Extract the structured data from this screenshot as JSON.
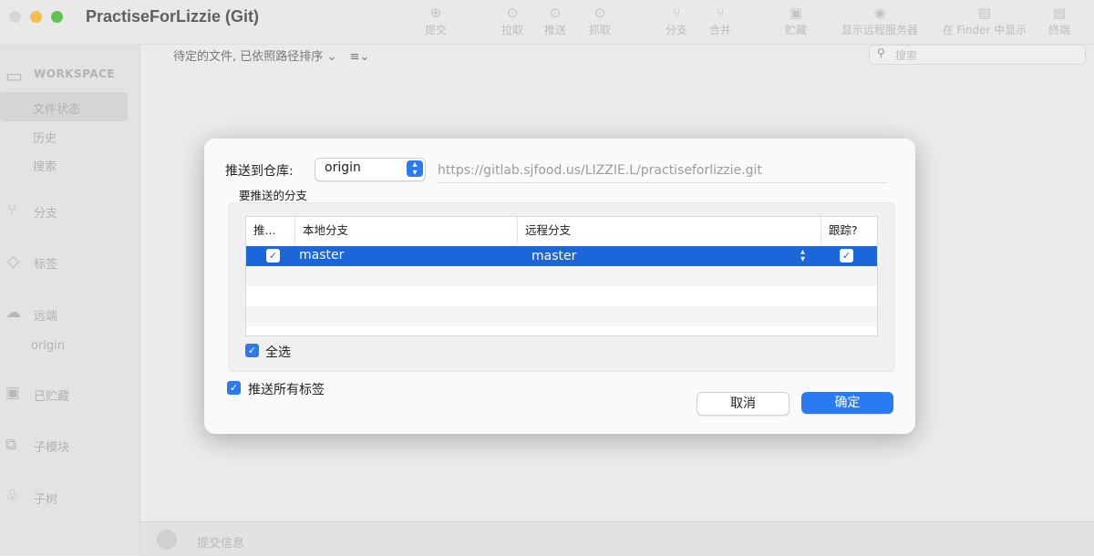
{
  "app": {
    "title": "PractiseForLizzie (Git)"
  },
  "toolbar": {
    "items": [
      {
        "label": "提交",
        "icon": "commit-icon"
      },
      {
        "label": "拉取",
        "icon": "pull-icon"
      },
      {
        "label": "推送",
        "icon": "push-icon"
      },
      {
        "label": "抓取",
        "icon": "fetch-icon"
      },
      {
        "label": "分支",
        "icon": "branch-icon"
      },
      {
        "label": "合并",
        "icon": "merge-icon"
      },
      {
        "label": "贮藏",
        "icon": "stash-icon"
      },
      {
        "label": "显示远程服务器",
        "icon": "remote-icon"
      },
      {
        "label": "在 Finder 中显示",
        "icon": "finder-icon"
      },
      {
        "label": "终端",
        "icon": "terminal-icon"
      }
    ]
  },
  "sidebar": {
    "workspace_label": "WORKSPACE",
    "items": [
      {
        "label": "文件状态"
      },
      {
        "label": "历史"
      },
      {
        "label": "搜索"
      }
    ],
    "sections": [
      {
        "label": "分支",
        "icon": "branch-icon"
      },
      {
        "label": "标签",
        "icon": "tag-icon"
      },
      {
        "label": "远端",
        "icon": "cloud-icon"
      },
      {
        "label": "已贮藏",
        "icon": "stash-icon"
      },
      {
        "label": "子模块",
        "icon": "submodule-icon"
      },
      {
        "label": "子树",
        "icon": "subtree-icon"
      }
    ],
    "remote_origin": "origin"
  },
  "main": {
    "filter_text": "待定的文件, 已依照路径排序",
    "search_placeholder": "搜索",
    "bottom_label": "提交信息"
  },
  "dialog": {
    "push_to_label": "推送到仓库:",
    "repo_value": "origin",
    "repo_url": "https://gitlab.sjfood.us/LIZZIE.L/practiseforlizzie.git",
    "branches_group_label": "要推送的分支",
    "table": {
      "headers": [
        "推...",
        "本地分支",
        "远程分支",
        "跟踪?"
      ],
      "rows": [
        {
          "push": true,
          "local": "master",
          "remote": "master",
          "track": true
        }
      ]
    },
    "select_all_label": "全选",
    "push_all_tags_label": "推送所有标签",
    "cancel_label": "取消",
    "ok_label": "确定"
  },
  "colors": {
    "accent": "#2a7bf2",
    "selected_row": "#1b66d8"
  }
}
